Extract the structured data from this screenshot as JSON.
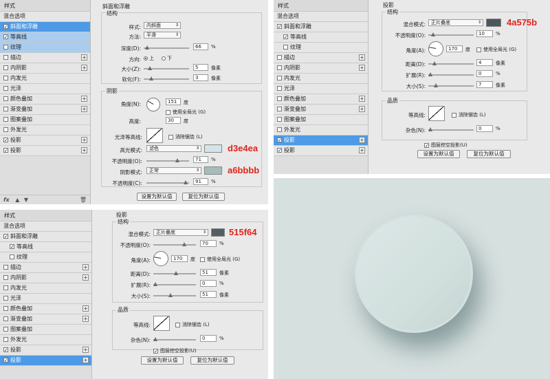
{
  "sidebar_a": {
    "title": "样式",
    "items": [
      {
        "label": "混合选项",
        "checkbox": false,
        "checked": false,
        "plus": false,
        "state": ""
      },
      {
        "label": "斜面和浮雕",
        "checkbox": true,
        "checked": true,
        "plus": false,
        "state": "sel"
      },
      {
        "label": "等高线",
        "checkbox": true,
        "checked": true,
        "plus": false,
        "state": "sub"
      },
      {
        "label": "纹理",
        "checkbox": true,
        "checked": false,
        "plus": false,
        "state": "sub"
      },
      {
        "label": "描边",
        "checkbox": true,
        "checked": false,
        "plus": true,
        "state": ""
      },
      {
        "label": "内阴影",
        "checkbox": true,
        "checked": false,
        "plus": true,
        "state": ""
      },
      {
        "label": "内发光",
        "checkbox": true,
        "checked": false,
        "plus": false,
        "state": ""
      },
      {
        "label": "光泽",
        "checkbox": true,
        "checked": false,
        "plus": false,
        "state": ""
      },
      {
        "label": "颜色叠加",
        "checkbox": true,
        "checked": false,
        "plus": true,
        "state": ""
      },
      {
        "label": "渐变叠加",
        "checkbox": true,
        "checked": false,
        "plus": true,
        "state": ""
      },
      {
        "label": "图案叠加",
        "checkbox": true,
        "checked": false,
        "plus": false,
        "state": ""
      },
      {
        "label": "外发光",
        "checkbox": true,
        "checked": false,
        "plus": false,
        "state": ""
      },
      {
        "label": "投影",
        "checkbox": true,
        "checked": true,
        "plus": true,
        "state": ""
      },
      {
        "label": "投影",
        "checkbox": true,
        "checked": true,
        "plus": true,
        "state": ""
      }
    ],
    "footer": "fx"
  },
  "bevel": {
    "title": "斜面和浮雕",
    "structure": "结构",
    "style_label": "样式:",
    "style_value": "内斜面",
    "method_label": "方法:",
    "method_value": "平滑",
    "depth_label": "深度(D):",
    "depth_value": "66",
    "depth_unit": "%",
    "direction_label": "方向:",
    "dir_up": "上",
    "dir_down": "下",
    "size_label": "大小(Z):",
    "size_value": "5",
    "size_unit": "像素",
    "soften_label": "软化(F):",
    "soften_value": "3",
    "soften_unit": "像素",
    "shading": "阴影",
    "angle_label": "角度(N):",
    "angle_value": "151",
    "angle_unit": "度",
    "global_light": "使用全局光 (G)",
    "altitude_label": "高度:",
    "altitude_value": "30",
    "altitude_unit": "度",
    "gloss_label": "光泽等高线:",
    "antialias": "消除锯齿 (L)",
    "hl_mode_label": "高光模式:",
    "hl_mode_value": "滤色",
    "hl_color": "#d3e4ea",
    "hl_annot": "d3e4ea",
    "hl_opacity_label": "不透明度(O):",
    "hl_opacity_value": "71",
    "hl_opacity_unit": "%",
    "sh_mode_label": "阴影模式:",
    "sh_mode_value": "正常",
    "sh_color": "#a6bbbb",
    "sh_annot": "a6bbbb",
    "sh_opacity_label": "不透明度(C):",
    "sh_opacity_value": "91",
    "sh_opacity_unit": "%",
    "btn_default": "设置为默认值",
    "btn_reset": "复位为默认值"
  },
  "sidebar_b": {
    "title": "样式",
    "items": [
      {
        "label": "混合选项",
        "checkbox": false,
        "checked": false,
        "plus": false,
        "state": ""
      },
      {
        "label": "斜面和浮雕",
        "checkbox": true,
        "checked": true,
        "plus": false,
        "state": ""
      },
      {
        "label": "等高线",
        "checkbox": true,
        "checked": true,
        "plus": false,
        "state": "ind"
      },
      {
        "label": "纹理",
        "checkbox": true,
        "checked": false,
        "plus": false,
        "state": "ind"
      },
      {
        "label": "描边",
        "checkbox": true,
        "checked": false,
        "plus": true,
        "state": ""
      },
      {
        "label": "内阴影",
        "checkbox": true,
        "checked": false,
        "plus": true,
        "state": ""
      },
      {
        "label": "内发光",
        "checkbox": true,
        "checked": false,
        "plus": false,
        "state": ""
      },
      {
        "label": "光泽",
        "checkbox": true,
        "checked": false,
        "plus": false,
        "state": ""
      },
      {
        "label": "颜色叠加",
        "checkbox": true,
        "checked": false,
        "plus": true,
        "state": ""
      },
      {
        "label": "渐变叠加",
        "checkbox": true,
        "checked": false,
        "plus": true,
        "state": ""
      },
      {
        "label": "图案叠加",
        "checkbox": true,
        "checked": false,
        "plus": false,
        "state": ""
      },
      {
        "label": "外发光",
        "checkbox": true,
        "checked": false,
        "plus": false,
        "state": ""
      },
      {
        "label": "投影",
        "checkbox": true,
        "checked": true,
        "plus": true,
        "state": "sel"
      },
      {
        "label": "投影",
        "checkbox": true,
        "checked": true,
        "plus": true,
        "state": ""
      }
    ]
  },
  "shadow1": {
    "title": "投影",
    "structure": "结构",
    "blend_label": "混合模式:",
    "blend_value": "正片叠底",
    "color": "#4a575b",
    "annot": "4a575b",
    "opacity_label": "不透明度(O):",
    "opacity_value": "10",
    "opacity_unit": "%",
    "angle_label": "角度(A):",
    "angle_value": "170",
    "angle_unit": "度",
    "global_light": "使用全局光 (G)",
    "distance_label": "距离(D):",
    "distance_value": "4",
    "distance_unit": "像素",
    "spread_label": "扩展(R):",
    "spread_value": "0",
    "spread_unit": "%",
    "size_label": "大小(S):",
    "size_value": "7",
    "size_unit": "像素",
    "quality": "品质",
    "contour_label": "等高线:",
    "antialias": "消除锯齿 (L)",
    "noise_label": "杂色(N):",
    "noise_value": "0",
    "noise_unit": "%",
    "knockout": "图层挖空投影(U)",
    "btn_default": "设置为默认值",
    "btn_reset": "复位为默认值"
  },
  "sidebar_c": {
    "title": "样式",
    "items": [
      {
        "label": "混合选项",
        "checkbox": false,
        "checked": false,
        "plus": false,
        "state": ""
      },
      {
        "label": "斜面和浮雕",
        "checkbox": true,
        "checked": true,
        "plus": false,
        "state": ""
      },
      {
        "label": "等高线",
        "checkbox": true,
        "checked": true,
        "plus": false,
        "state": "ind"
      },
      {
        "label": "纹理",
        "checkbox": true,
        "checked": false,
        "plus": false,
        "state": "ind"
      },
      {
        "label": "描边",
        "checkbox": true,
        "checked": false,
        "plus": true,
        "state": ""
      },
      {
        "label": "内阴影",
        "checkbox": true,
        "checked": false,
        "plus": true,
        "state": ""
      },
      {
        "label": "内发光",
        "checkbox": true,
        "checked": false,
        "plus": false,
        "state": ""
      },
      {
        "label": "光泽",
        "checkbox": true,
        "checked": false,
        "plus": false,
        "state": ""
      },
      {
        "label": "颜色叠加",
        "checkbox": true,
        "checked": false,
        "plus": true,
        "state": ""
      },
      {
        "label": "渐变叠加",
        "checkbox": true,
        "checked": false,
        "plus": true,
        "state": ""
      },
      {
        "label": "图案叠加",
        "checkbox": true,
        "checked": false,
        "plus": false,
        "state": ""
      },
      {
        "label": "外发光",
        "checkbox": true,
        "checked": false,
        "plus": false,
        "state": ""
      },
      {
        "label": "投影",
        "checkbox": true,
        "checked": true,
        "plus": true,
        "state": ""
      },
      {
        "label": "投影",
        "checkbox": true,
        "checked": true,
        "plus": true,
        "state": "sel"
      }
    ]
  },
  "shadow2": {
    "title": "投影",
    "structure": "结构",
    "blend_label": "混合模式:",
    "blend_value": "正片叠底",
    "color": "#515f64",
    "annot": "515f64",
    "opacity_label": "不透明度(O):",
    "opacity_value": "70",
    "opacity_unit": "%",
    "angle_label": "角度(A):",
    "angle_value": "170",
    "angle_unit": "度",
    "global_light": "使用全局光 (G)",
    "distance_label": "距离(D):",
    "distance_value": "51",
    "distance_unit": "像素",
    "spread_label": "扩展(R):",
    "spread_value": "0",
    "spread_unit": "%",
    "size_label": "大小(S):",
    "size_value": "51",
    "size_unit": "像素",
    "quality": "品质",
    "contour_label": "等高线:",
    "antialias": "消除锯齿 (L)",
    "noise_label": "杂色(N):",
    "noise_value": "0",
    "noise_unit": "%",
    "knockout": "图层挖空投影(U)",
    "btn_default": "设置为默认值",
    "btn_reset": "复位为默认值"
  }
}
